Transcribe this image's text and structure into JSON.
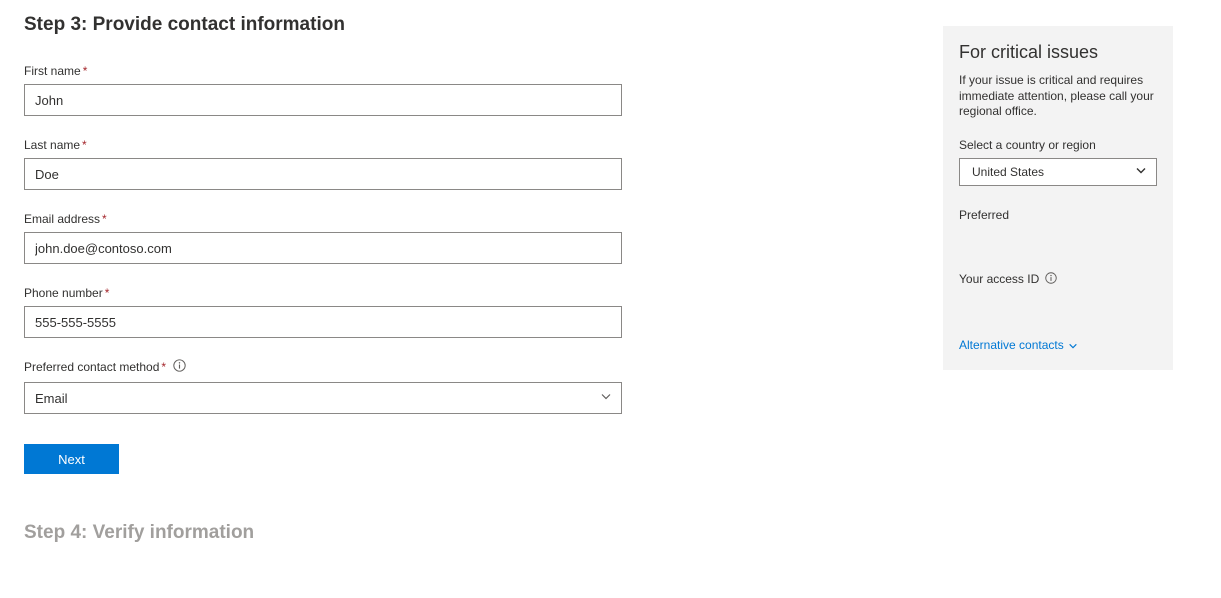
{
  "step3": {
    "heading": "Step 3: Provide contact information",
    "fields": {
      "first_name": {
        "label": "First name",
        "value": "John"
      },
      "last_name": {
        "label": "Last name",
        "value": "Doe"
      },
      "email": {
        "label": "Email address",
        "value": "john.doe@contoso.com"
      },
      "phone": {
        "label": "Phone number",
        "value": "555-555-5555"
      },
      "contact_method": {
        "label": "Preferred contact method",
        "value": "Email"
      }
    },
    "next_button": "Next"
  },
  "step4": {
    "heading": "Step 4: Verify information"
  },
  "sidebar": {
    "heading": "For critical issues",
    "description": "If your issue is critical and requires immediate attention, please call your regional office.",
    "country_label": "Select a country or region",
    "country_value": "United States",
    "preferred_label": "Preferred",
    "preferred_value": "",
    "access_id_label": "Your access ID",
    "access_id_value": "",
    "alt_contacts_label": "Alternative contacts"
  }
}
